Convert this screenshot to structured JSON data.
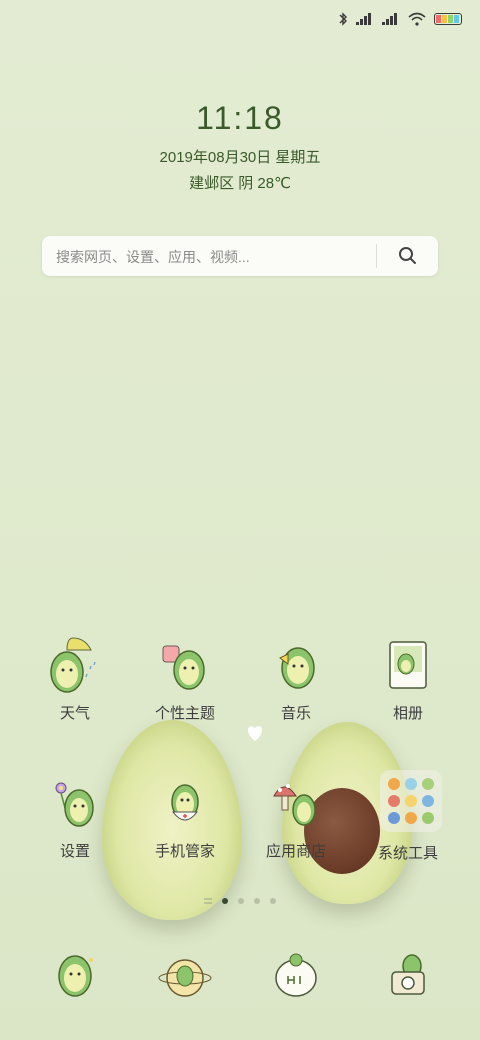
{
  "clock": {
    "time": "11:18",
    "date": "2019年08月30日  星期五",
    "weather": "建邺区  阴  28℃"
  },
  "search": {
    "placeholder": "搜索网页、设置、应用、视频..."
  },
  "apps_row1": [
    {
      "label": "天气",
      "icon": "weather-avocado-icon"
    },
    {
      "label": "个性主题",
      "icon": "themes-avocado-icon"
    },
    {
      "label": "音乐",
      "icon": "music-avocado-icon"
    },
    {
      "label": "相册",
      "icon": "gallery-avocado-icon"
    }
  ],
  "apps_row2": [
    {
      "label": "设置",
      "icon": "settings-avocado-icon"
    },
    {
      "label": "手机管家",
      "icon": "phone-manager-avocado-icon"
    },
    {
      "label": "应用商店",
      "icon": "app-store-avocado-icon"
    },
    {
      "label": "系统工具",
      "icon": "system-tools-folder-icon"
    }
  ],
  "colors": {
    "accent": "#3a5a2b",
    "background": "#e3ecd2"
  },
  "page_indicator": {
    "pages": 4,
    "active": 1
  }
}
